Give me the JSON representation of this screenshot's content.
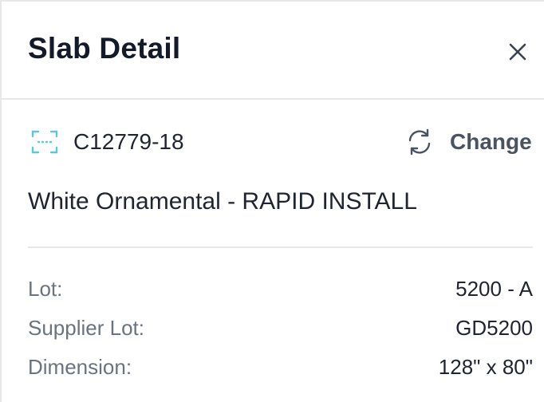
{
  "header": {
    "title": "Slab Detail",
    "close_icon": "close-icon"
  },
  "slab": {
    "id": "C12779-18",
    "id_icon": "barcode-scan-icon",
    "change_label": "Change",
    "change_icon": "refresh-icon",
    "name": "White Ornamental - RAPID INSTALL"
  },
  "details": [
    {
      "label": "Lot:",
      "value": "5200 - A"
    },
    {
      "label": "Supplier Lot:",
      "value": "GD5200"
    },
    {
      "label": "Dimension:",
      "value": "128\" x 80\""
    }
  ],
  "colors": {
    "title": "#141a29",
    "text": "#1f2430",
    "label": "#6b7280",
    "change": "#4b5260",
    "scan_icon": "#5cc8d8",
    "divider": "#e5e7eb"
  }
}
